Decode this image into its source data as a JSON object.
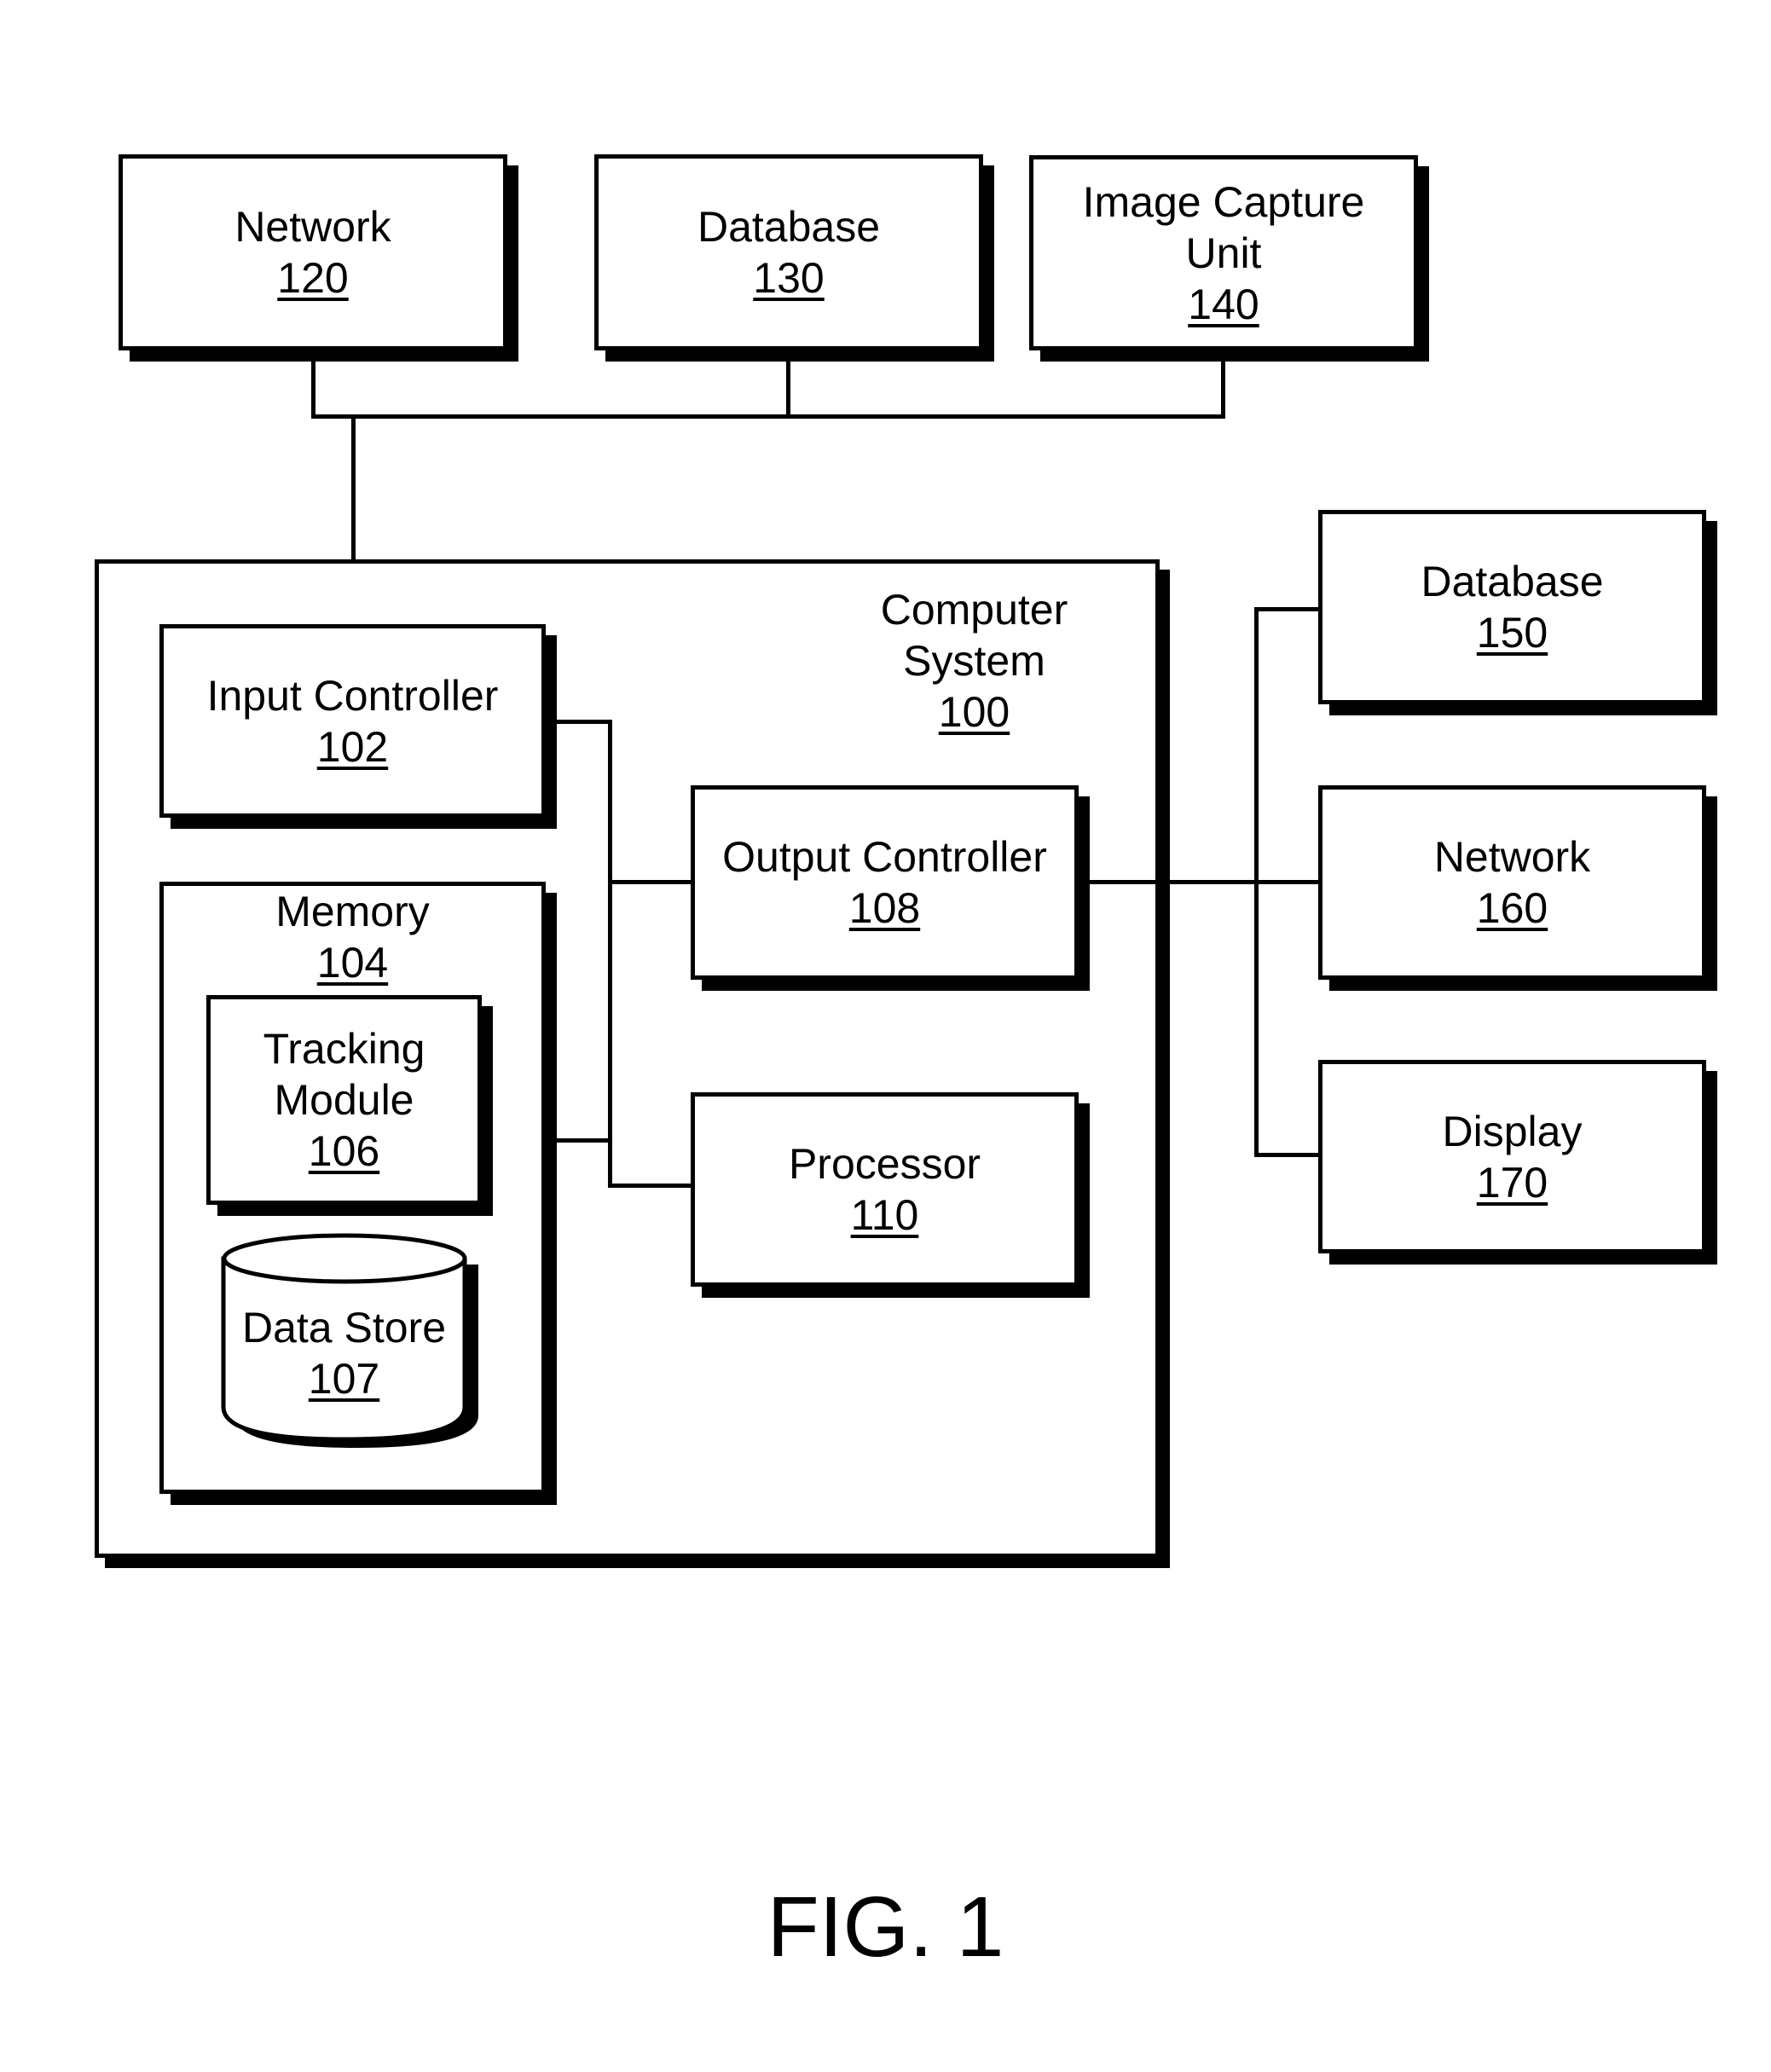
{
  "figure_label": "FIG. 1",
  "top_row": [
    {
      "name": "Network",
      "ref": "120"
    },
    {
      "name": "Database",
      "ref": "130"
    },
    {
      "name": "Image Capture Unit",
      "line1": "Image Capture",
      "line2": "Unit",
      "ref": "140"
    }
  ],
  "computer_system": {
    "line1": "Computer",
    "line2": "System",
    "ref": "100",
    "components": {
      "input_controller": {
        "name": "Input Controller",
        "ref": "102"
      },
      "memory": {
        "name": "Memory",
        "ref": "104",
        "tracking_module": {
          "line1": "Tracking",
          "line2": "Module",
          "ref": "106"
        },
        "data_store": {
          "name": "Data Store",
          "ref": "107"
        }
      },
      "output_controller": {
        "name": "Output Controller",
        "ref": "108"
      },
      "processor": {
        "name": "Processor",
        "ref": "110"
      }
    }
  },
  "right_column": [
    {
      "name": "Database",
      "ref": "150"
    },
    {
      "name": "Network",
      "ref": "160"
    },
    {
      "name": "Display",
      "ref": "170"
    }
  ]
}
